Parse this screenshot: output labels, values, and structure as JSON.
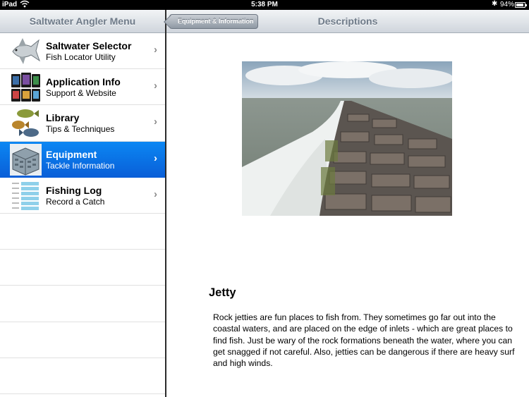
{
  "status": {
    "carrier": "iPad",
    "time": "5:38 PM",
    "battery_text": "94%",
    "battery_level": 0.94
  },
  "sidebar": {
    "title": "Saltwater Angler Menu",
    "items": [
      {
        "title": "Saltwater Selector",
        "subtitle": "Fish Locator Utility",
        "icon": "fish-icon",
        "selected": false
      },
      {
        "title": "Application Info",
        "subtitle": "Support & Website",
        "icon": "devices-icon",
        "selected": false
      },
      {
        "title": "Library",
        "subtitle": "Tips & Techniques",
        "icon": "fish-tips-icon",
        "selected": false
      },
      {
        "title": "Equipment",
        "subtitle": "Tackle Information",
        "icon": "tackle-box-icon",
        "selected": true
      },
      {
        "title": "Fishing Log",
        "subtitle": "Record a Catch",
        "icon": "log-sheet-icon",
        "selected": false
      }
    ],
    "chevron": "›"
  },
  "detail": {
    "back_label": "Equipment & Information",
    "title": "Descriptions",
    "heading": "Jetty",
    "body": "Rock jetties are fun places to fish from. They sometimes go far out into the coastal waters, and are placed on the edge of inlets - which are great places to find fish. Just be wary of the rock formations beneath the water, where you can get snagged if not careful. Also, jetties can be dangerous if there are heavy surf and high winds."
  },
  "colors": {
    "selection": "#0a6fe6",
    "nav_title": "#6f7b89"
  }
}
